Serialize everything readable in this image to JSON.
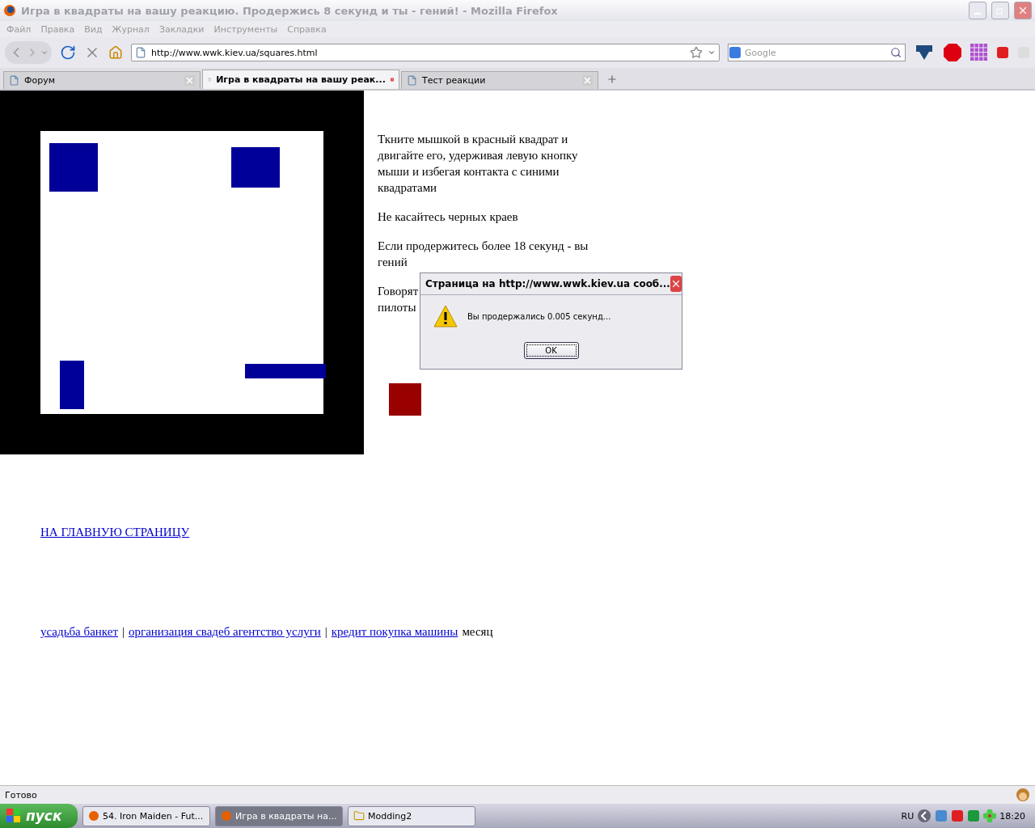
{
  "window": {
    "title": "Игра в квадраты на вашу реакцию. Продержись 8 секунд и ты - гений! - Mozilla Firefox"
  },
  "menu": [
    "Файл",
    "Правка",
    "Вид",
    "Журнал",
    "Закладки",
    "Инструменты",
    "Справка"
  ],
  "address": {
    "value": "http://www.wwk.kiev.ua/squares.html"
  },
  "search": {
    "placeholder": "Google"
  },
  "tabs": [
    {
      "label": "Форум",
      "selected": false
    },
    {
      "label": "Игра в квадраты на вашу реак...",
      "selected": true
    },
    {
      "label": "Тест реакции",
      "selected": false
    }
  ],
  "instructions": [
    "Ткните мышкой в красный квадрат и двигайте его, удерживая левую кнопку мыши и избегая контакта с синими квадратами",
    "Не касайтесь черных краев",
    "Если продержитесь более 18 секунд - вы гений"
  ],
  "partial_paragraph": [
    "Говорят",
    "пилоты"
  ],
  "home_link": "НА ГЛАВНУЮ СТРАНИЦУ",
  "footer_links": [
    "усадьба банкет",
    "организация свадеб агентство услуги",
    "кредит покупка машины"
  ],
  "footer_separator": "|",
  "footer_tail": "месяц",
  "dialog": {
    "title": "Страница на http://www.wwk.kiev.ua сооб...",
    "message": "Вы продержались 0.005 секунд...",
    "button": "OK"
  },
  "status_bar": "Готово",
  "taskbar": {
    "start": "пуск",
    "items": [
      {
        "label": "54. Iron Maiden - Fut...",
        "selected": false
      },
      {
        "label": "Игра в квадраты на...",
        "selected": true
      },
      {
        "label": "Modding2",
        "selected": false
      }
    ],
    "language": "RU",
    "clock": "18:20"
  }
}
